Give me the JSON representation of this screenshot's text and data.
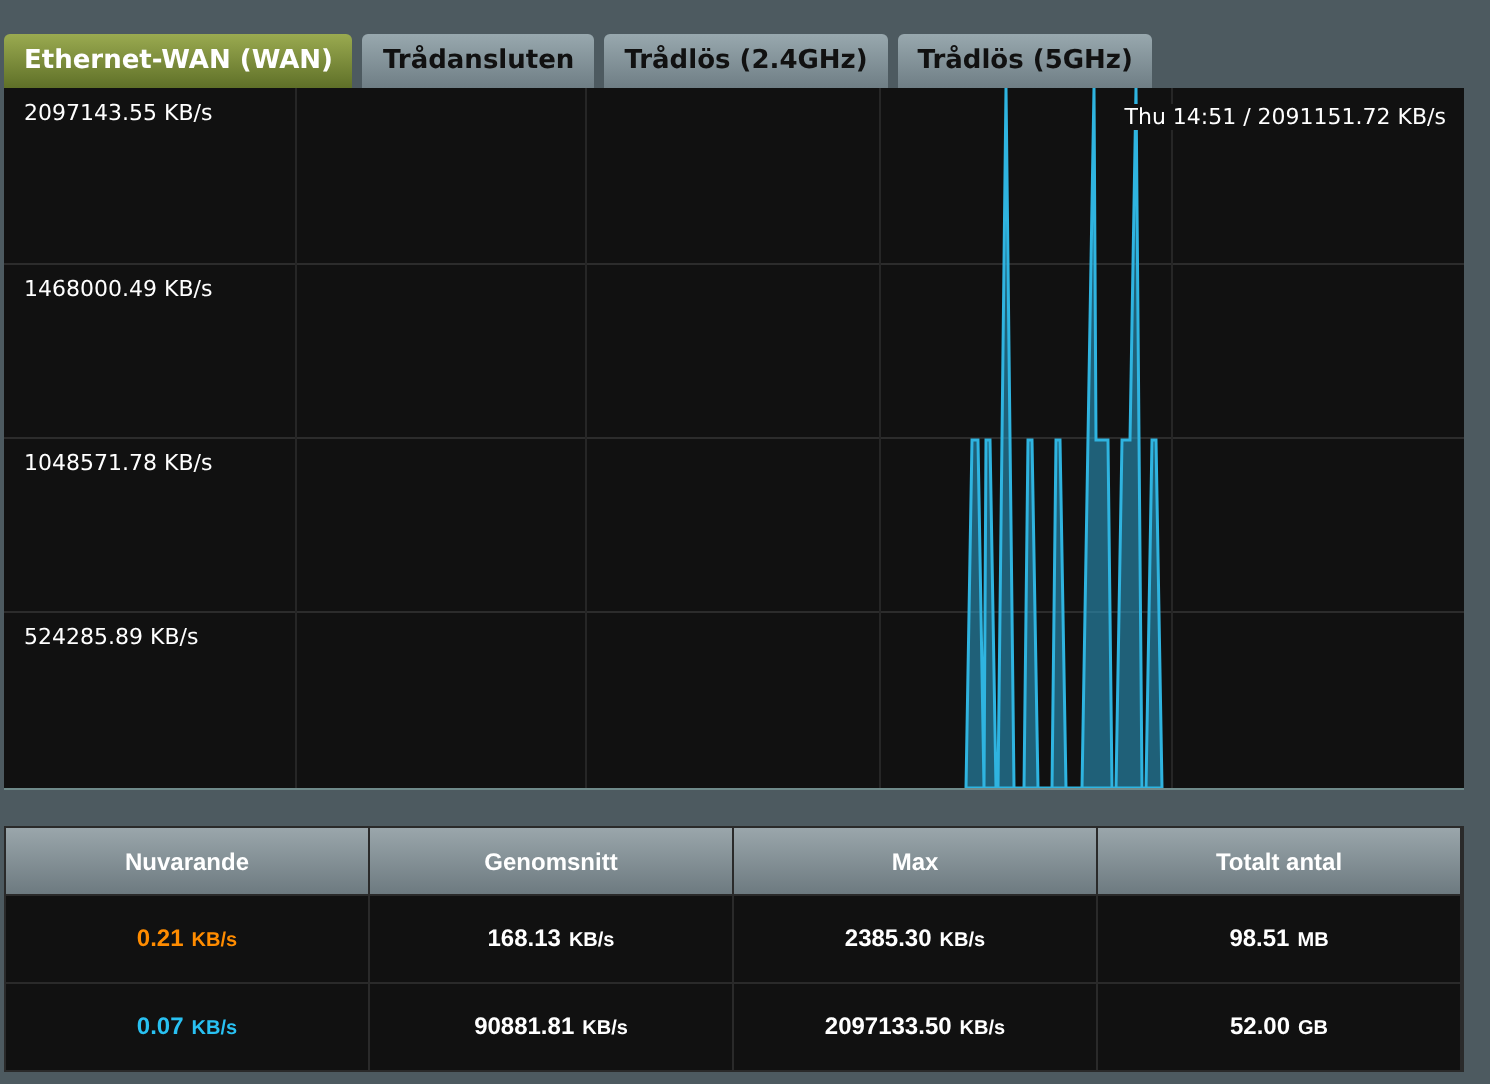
{
  "tabs": [
    {
      "label": "Ethernet-WAN (WAN)",
      "selected": true
    },
    {
      "label": "Trådansluten",
      "selected": false
    },
    {
      "label": "Trådlös (2.4GHz)",
      "selected": false
    },
    {
      "label": "Trådlös (5GHz)",
      "selected": false
    }
  ],
  "chart": {
    "y_labels": [
      "2097143.55 KB/s",
      "1468000.49 KB/s",
      "1048571.78 KB/s",
      "524285.89 KB/s"
    ],
    "tooltip": "Thu 14:51 / 2091151.72 KB/s"
  },
  "table": {
    "columns": [
      "Nuvarande",
      "Genomsnitt",
      "Max",
      "Totalt antal"
    ],
    "rows": [
      {
        "color": "#ff8c00",
        "cells": [
          {
            "value": "0.21",
            "unit": "KB/s"
          },
          {
            "value": "168.13",
            "unit": "KB/s"
          },
          {
            "value": "2385.30",
            "unit": "KB/s"
          },
          {
            "value": "98.51",
            "unit": "MB"
          }
        ]
      },
      {
        "color": "#29c1f2",
        "cells": [
          {
            "value": "0.07",
            "unit": "KB/s"
          },
          {
            "value": "90881.81",
            "unit": "KB/s"
          },
          {
            "value": "2097133.50",
            "unit": "KB/s"
          },
          {
            "value": "52.00",
            "unit": "GB"
          }
        ]
      }
    ]
  }
}
